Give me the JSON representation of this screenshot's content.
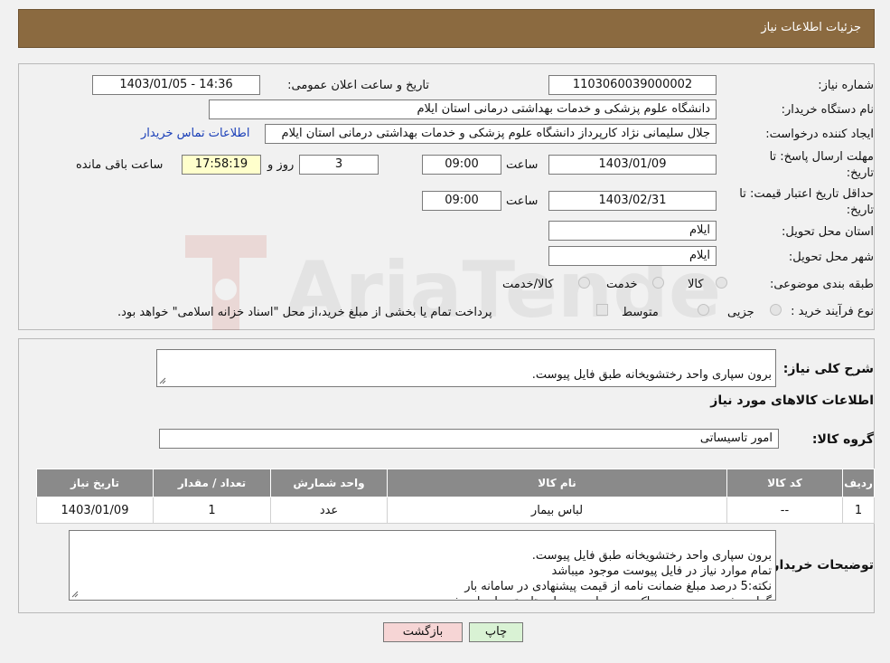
{
  "header": {
    "title": "جزئیات اطلاعات نیاز"
  },
  "form": {
    "need_number_label": "شماره نیاز:",
    "need_number": "1103060039000002",
    "announce_label": "تاریخ و ساعت اعلان عمومی:",
    "announce_value": "1403/01/05 - 14:36",
    "buyer_org_label": "نام دستگاه خریدار:",
    "buyer_org": "دانشگاه علوم پزشکی و خدمات بهداشتی درمانی استان ایلام",
    "creator_label": "ایجاد کننده درخواست:",
    "creator": "جلال سلیمانی نژاد کارپرداز دانشگاه علوم پزشکی و خدمات بهداشتی درمانی استان ایلام",
    "contact_link": "اطلاعات تماس خریدار",
    "deadline_label_1": "مهلت ارسال پاسخ: تا",
    "deadline_label_2": "تاریخ:",
    "deadline_date": "1403/01/09",
    "time_label": "ساعت",
    "deadline_time": "09:00",
    "remaining_days": "3",
    "days_label": "روز و",
    "remaining_time": "17:58:19",
    "remaining_label": "ساعت باقی مانده",
    "validity_label_1": "حداقل تاریخ اعتبار قیمت: تا",
    "validity_label_2": "تاریخ:",
    "validity_date": "1403/02/31",
    "validity_time": "09:00",
    "province_label": "استان محل تحویل:",
    "province": "ایلام",
    "city_label": "شهر محل تحویل:",
    "city": "ایلام",
    "category_label": "طبقه بندی موضوعی:",
    "category_options": [
      "کالا",
      "خدمت",
      "کالا/خدمت"
    ],
    "process_label": "نوع فرآیند خرید :",
    "process_options": [
      "جزیی",
      "متوسط"
    ],
    "payment_note": "پرداخت تمام یا بخشی از مبلغ خرید،از محل \"اسناد خزانه اسلامی\" خواهد بود."
  },
  "details": {
    "description_label": "شرح کلی نیاز:",
    "description": "برون سپاری واحد رختشویخانه طبق فایل پیوست.",
    "goods_info_title": "اطلاعات کالاهای مورد نیاز",
    "group_label": "گروه کالا:",
    "group_value": "امور تاسیساتی"
  },
  "table": {
    "headers": [
      "ردیف",
      "کد کالا",
      "نام کالا",
      "واحد شمارش",
      "تعداد / مقدار",
      "تاریخ نیاز"
    ],
    "rows": [
      [
        "1",
        "--",
        "لباس بیمار",
        "عدد",
        "1",
        "1403/01/09"
      ]
    ]
  },
  "buyer_notes": {
    "label": "توضیحات خریدار:",
    "text": "برون سپاری واحد رختشویخانه طبق فایل پیوست.\nتمام موارد نیاز در فایل پیوست موجود میباشد\nنکته:5 درصد مبلغ ضمانت نامه از قیمت پیشنهادی در سامانه بار\nگزاری شود و به صورت پاکت به حراست بیمارستان تحویل داده شود."
  },
  "buttons": {
    "print": "چاپ",
    "back": "بازگشت"
  },
  "watermark": {
    "text": "AriaTender.neT"
  },
  "colors": {
    "header_bg": "#8b6a40",
    "table_header_bg": "#8a8a8a",
    "link": "#1a3fb8",
    "remaining_bg": "#ffffcc",
    "back_button_bg": "#f6d5d5",
    "print_button_bg": "#d9f2d4"
  }
}
